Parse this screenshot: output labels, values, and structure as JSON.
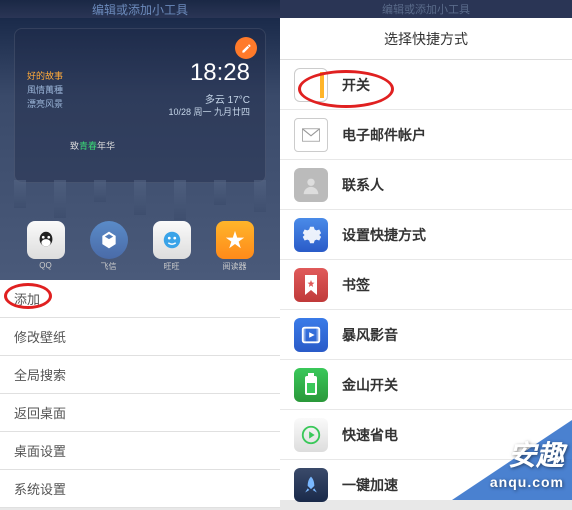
{
  "left": {
    "header": "编辑或添加小工具",
    "clock": "18:28",
    "weather": "多云 17°C",
    "date": "10/28 周一 九月廿四",
    "widget_lines": [
      "好的故事",
      "風情萬種",
      "漂亮风景"
    ],
    "poem_prefix": "致",
    "poem_mid": "青春",
    "poem_suffix": "年华",
    "dock": [
      {
        "label": "QQ",
        "icon": "qq"
      },
      {
        "label": "飞信",
        "icon": "feixin"
      },
      {
        "label": "旺旺",
        "icon": "wangwang"
      },
      {
        "label": "阅读器",
        "icon": "read"
      }
    ],
    "menu": [
      "添加",
      "修改壁纸",
      "全局搜索",
      "返回桌面",
      "桌面设置",
      "系统设置"
    ]
  },
  "right": {
    "header": "编辑或添加小工具",
    "title": "选择快捷方式",
    "items": [
      {
        "label": "开关",
        "icon": "switch"
      },
      {
        "label": "电子邮件帐户",
        "icon": "mail"
      },
      {
        "label": "联系人",
        "icon": "contact"
      },
      {
        "label": "设置快捷方式",
        "icon": "settings"
      },
      {
        "label": "书签",
        "icon": "bookmark"
      },
      {
        "label": "暴风影音",
        "icon": "baofeng"
      },
      {
        "label": "金山开关",
        "icon": "jinshan"
      },
      {
        "label": "快速省电",
        "icon": "power"
      },
      {
        "label": "一键加速",
        "icon": "speed"
      }
    ]
  },
  "watermark": {
    "main": "安趣",
    "sub": "anqu.com"
  }
}
